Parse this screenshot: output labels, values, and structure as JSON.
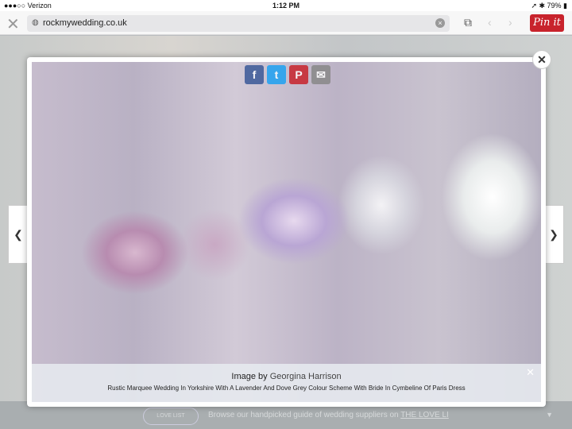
{
  "status": {
    "carrier": "●●●○○ Verizon",
    "time": "1:12 PM",
    "battery": "79%"
  },
  "toolbar": {
    "url": "rockmywedding.co.uk",
    "pin_label": "Pin it"
  },
  "banner": {
    "text": "Browse our handpicked guide of wedding suppliers on ",
    "link": "THE LOVE LI",
    "logo": "LOVE LIST"
  },
  "share": {
    "facebook": "f",
    "twitter": "t",
    "pinterest": "P",
    "email": "✉"
  },
  "caption": {
    "prefix": "Image by ",
    "author": "Georgina Harrison",
    "title": "Rustic Marquee Wedding In Yorkshire With A Lavender And Dove Grey Colour Scheme With Bride In Cymbeline Of Paris Dress"
  },
  "colors": {
    "pinterest": "#c8232c",
    "facebook": "#3b5998",
    "twitter": "#1da1f2"
  }
}
